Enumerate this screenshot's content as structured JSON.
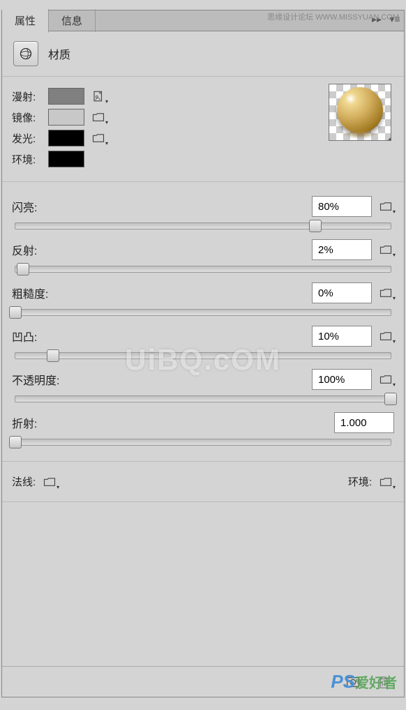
{
  "watermark": {
    "top": "思缘设计论坛 WWW.MISSYUAN.COM",
    "center": "UiBQ.cOM",
    "bottom_ps": "PS",
    "bottom_cn": "爱好者"
  },
  "tabs": {
    "properties": "属性",
    "info": "信息"
  },
  "header": {
    "label": "材质"
  },
  "colors": {
    "diffuse": {
      "label": "漫射:",
      "value": "#808080"
    },
    "mirror": {
      "label": "镜像:",
      "value": "#c8c8c8"
    },
    "glow": {
      "label": "发光:",
      "value": "#000000"
    },
    "env": {
      "label": "环境:",
      "value": "#000000"
    }
  },
  "sliders": {
    "shine": {
      "label": "闪亮:",
      "value": "80%",
      "pct": 80
    },
    "reflection": {
      "label": "反射:",
      "value": "2%",
      "pct": 2
    },
    "roughness": {
      "label": "粗糙度:",
      "value": "0%",
      "pct": 0
    },
    "bump": {
      "label": "凹凸:",
      "value": "10%",
      "pct": 10
    },
    "opacity": {
      "label": "不透明度:",
      "value": "100%",
      "pct": 100
    },
    "refraction": {
      "label": "折射:",
      "value": "1.000",
      "pct": 0
    }
  },
  "bottom": {
    "normal": "法线:",
    "env": "环境:"
  }
}
